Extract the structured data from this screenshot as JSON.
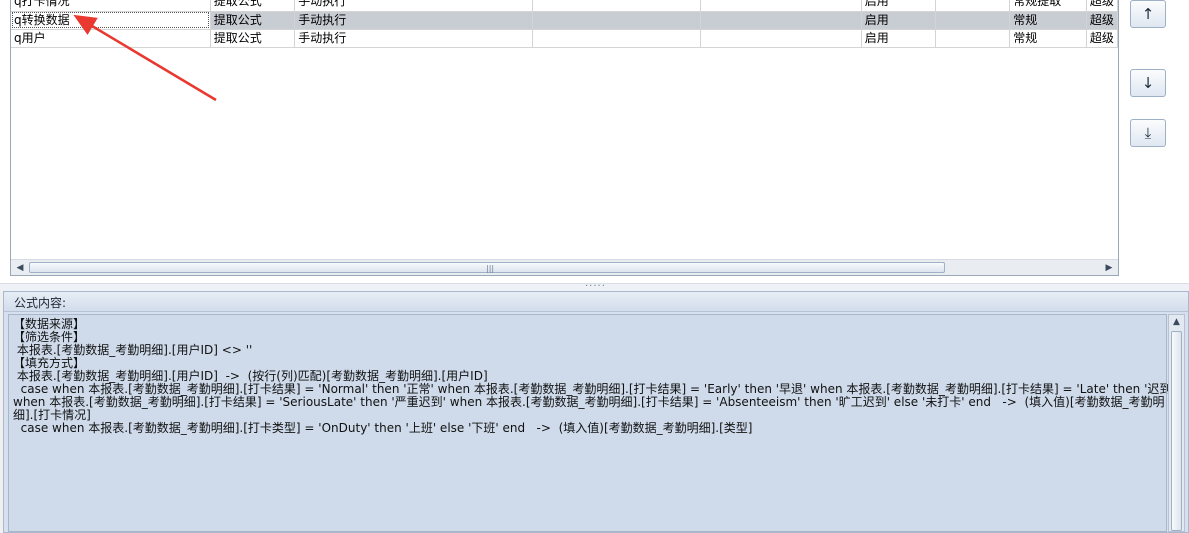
{
  "grid": {
    "rows": [
      {
        "name": "q打卡情况",
        "type": "提取公式",
        "mode": "手动执行",
        "c4": "",
        "c5": "",
        "status": "启用",
        "c7": "",
        "cat": "常规提取",
        "level": "超级"
      },
      {
        "name": "q转换数据",
        "type": "提取公式",
        "mode": "手动执行",
        "c4": "",
        "c5": "",
        "status": "启用",
        "c7": "",
        "cat": "常规",
        "level": "超级"
      },
      {
        "name": "q用户",
        "type": "提取公式",
        "mode": "手动执行",
        "c4": "",
        "c5": "",
        "status": "启用",
        "c7": "",
        "cat": "常规",
        "level": "超级"
      }
    ],
    "scroll_left_arrow": "◀",
    "scroll_right_arrow": "▶",
    "scroll_grip": "|||"
  },
  "side_buttons": {
    "top": "↑",
    "down": "↓",
    "bottom": "⤓"
  },
  "splitter_dots": "·····",
  "formula_panel": {
    "title": "公式内容:",
    "lines": [
      "【数据来源】",
      "",
      "【筛选条件】",
      " 本报表.[考勤数据_考勤明细].[用户ID] <> ''",
      "【填充方式】",
      " 本报表.[考勤数据_考勤明细].[用户ID]  ->  (按行(列)匹配)[考勤数据_考勤明细].[用户ID]",
      "  case when 本报表.[考勤数据_考勤明细].[打卡结果] = 'Normal' then '正常' when 本报表.[考勤数据_考勤明细].[打卡结果] = 'Early' then '早退' when 本报表.[考勤数据_考勤明细].[打卡结果] = 'Late' then '迟到'",
      "when 本报表.[考勤数据_考勤明细].[打卡结果] = 'SeriousLate' then '严重迟到' when 本报表.[考勤数据_考勤明细].[打卡结果] = 'Absenteeism' then '旷工迟到' else '未打卡' end   ->  (填入值)[考勤数据_考勤明",
      "细].[打卡情况]",
      "  case when 本报表.[考勤数据_考勤明细].[打卡类型] = 'OnDuty' then '上班' else '下班' end   ->  (填入值)[考勤数据_考勤明细].[类型]"
    ],
    "scroll_up_arrow": "▲"
  },
  "colors": {
    "annotation_arrow": "#e8382f",
    "selected_row": "#c8ccd3",
    "panel_background": "#cfdbeb"
  }
}
